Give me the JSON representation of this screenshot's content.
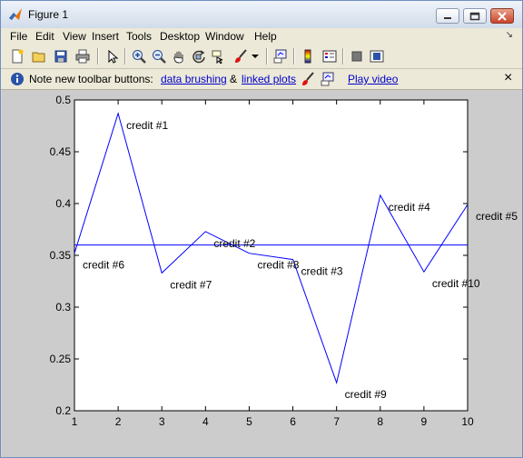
{
  "window": {
    "title": "Figure 1"
  },
  "menu": {
    "items": [
      {
        "label": "File",
        "name": "menu-file"
      },
      {
        "label": "Edit",
        "name": "menu-edit"
      },
      {
        "label": "View",
        "name": "menu-view"
      },
      {
        "label": "Insert",
        "name": "menu-insert"
      },
      {
        "label": "Tools",
        "name": "menu-tools"
      },
      {
        "label": "Desktop",
        "name": "menu-desktop"
      },
      {
        "label": "Window",
        "name": "menu-window"
      },
      {
        "label": "Help",
        "name": "menu-help"
      }
    ]
  },
  "toolbar": {
    "icons": [
      "new-figure-icon",
      "open-icon",
      "save-icon",
      "print-icon",
      "pointer-icon",
      "zoom-in-icon",
      "zoom-out-icon",
      "pan-hand-icon",
      "rotate-3d-icon",
      "data-cursor-icon",
      "brush-icon",
      "brush-dropdown-icon",
      "link-plot-icon",
      "colorbar-icon",
      "legend-icon",
      "hide-plot-tools-icon",
      "show-plot-tools-icon"
    ]
  },
  "notice": {
    "prefix": "Note new toolbar buttons:",
    "link1": "data brushing",
    "amp": "&",
    "link2": "linked plots",
    "video": "Play video",
    "close": "×"
  },
  "colors": {
    "line": "#0000ff",
    "axes_bg": "#ffffff",
    "figure_bg": "#cccccc"
  },
  "chart_data": {
    "type": "line",
    "x": [
      1,
      2,
      3,
      4,
      5,
      6,
      7,
      8,
      9,
      10
    ],
    "series": [
      {
        "values": [
          0.352,
          0.487,
          0.333,
          0.373,
          0.352,
          0.346,
          0.227,
          0.408,
          0.334,
          0.399
        ]
      },
      {
        "values": [
          0.36,
          0.36,
          0.36,
          0.36,
          0.36,
          0.36,
          0.36,
          0.36,
          0.36,
          0.36
        ]
      }
    ],
    "annotations": [
      {
        "text": "credit #6",
        "x": 1,
        "y": 0.352
      },
      {
        "text": "credit #1",
        "x": 2,
        "y": 0.487
      },
      {
        "text": "credit #7",
        "x": 3,
        "y": 0.333
      },
      {
        "text": "credit #2",
        "x": 4,
        "y": 0.373
      },
      {
        "text": "credit #8",
        "x": 5,
        "y": 0.352
      },
      {
        "text": "credit #3",
        "x": 6,
        "y": 0.346
      },
      {
        "text": "credit #9",
        "x": 7,
        "y": 0.227
      },
      {
        "text": "credit #4",
        "x": 8,
        "y": 0.408
      },
      {
        "text": "credit #10",
        "x": 9,
        "y": 0.334
      },
      {
        "text": "credit #5",
        "x": 10,
        "y": 0.399
      }
    ],
    "xlim": [
      1,
      10
    ],
    "ylim": [
      0.2,
      0.5
    ],
    "xticks": [
      "1",
      "2",
      "3",
      "4",
      "5",
      "6",
      "7",
      "8",
      "9",
      "10"
    ],
    "yticks": [
      "0.2",
      "0.25",
      "0.3",
      "0.35",
      "0.4",
      "0.45",
      "0.5"
    ],
    "grid": false,
    "title": "",
    "xlabel": "",
    "ylabel": ""
  }
}
